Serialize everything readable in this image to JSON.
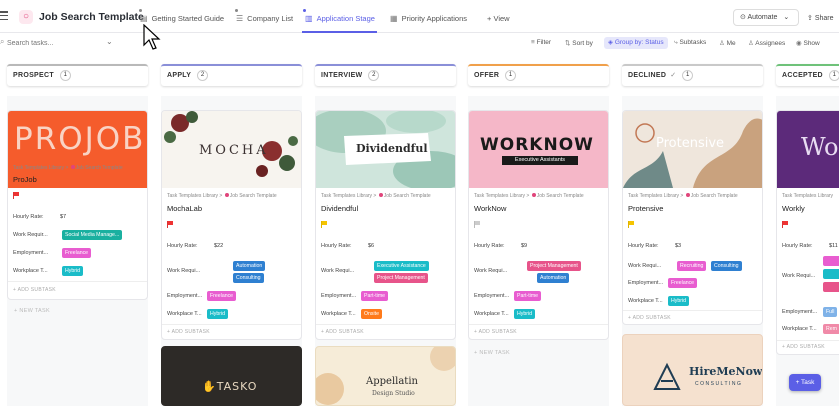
{
  "header": {
    "title": "Job Search Template",
    "tabs": [
      {
        "label": "Getting Started Guide"
      },
      {
        "label": "Company List"
      },
      {
        "label": "Application Stage"
      },
      {
        "label": "Priority Applications"
      }
    ],
    "add_view": "+ View",
    "automate": "Automate",
    "share": "Share"
  },
  "toolbar": {
    "search_placeholder": "Search tasks...",
    "filter": "Filter",
    "sort": "Sort by",
    "group": "Group by: Status",
    "subtasks": "Subtasks",
    "me": "Me",
    "assignees": "Assignees",
    "show": "Show"
  },
  "columns": [
    {
      "name": "PROSPECT",
      "count": "1",
      "color": "#b9b9b9"
    },
    {
      "name": "APPLY",
      "count": "2",
      "color": "#8a8fd8"
    },
    {
      "name": "INTERVIEW",
      "count": "2",
      "color": "#8a8fd8"
    },
    {
      "name": "OFFER",
      "count": "1",
      "color": "#f0a04b"
    },
    {
      "name": "DECLINED",
      "count": "1",
      "color": "#c9c9c9"
    },
    {
      "name": "ACCEPTED",
      "count": "1",
      "color": "#6fc27a"
    }
  ],
  "common": {
    "crumb_a": "Task Templates Library",
    "crumb_b": "Job Search Template",
    "hourly_rate": "Hourly Rate:",
    "work_req": "Work Requir...",
    "work_req_short": "Work Requi...",
    "employment": "Employment...",
    "workplace": "Workplace T...",
    "add_subtask": "+ ADD SUBTASK",
    "new_task": "+ NEW TASK"
  },
  "cards": {
    "projob": {
      "cover": "PROJOB",
      "name": "ProJob",
      "rate": "$7",
      "work": "Social Media Manage...",
      "employment": "Freelance",
      "workplace": "Hybrid"
    },
    "mochalab": {
      "cover": "MOCHA",
      "name": "MochaLab",
      "rate": "$22",
      "work1": "Automation",
      "work2": "Consulting",
      "employment": "Freelance",
      "workplace": "Hybrid"
    },
    "dividendful": {
      "cover": "Dividendful",
      "name": "Dividendful",
      "rate": "$6",
      "work1": "Executive Assistance",
      "work2": "Project Management",
      "employment": "Part-time",
      "workplace": "Onsite"
    },
    "worknow": {
      "cover": "WORKNOW",
      "cover_sub": "Executive Assistants",
      "name": "WorkNow",
      "rate": "$9",
      "work1": "Project Management",
      "work2": "Automation",
      "employment": "Part-time",
      "workplace": "Hybrid"
    },
    "protensive": {
      "cover": "Protensive",
      "name": "Protensive",
      "rate": "$3",
      "work1": "Recruiting",
      "work2": "Consulting",
      "employment": "Freelance",
      "workplace": "Hybrid"
    },
    "workly": {
      "cover": "Wo",
      "name": "Workly",
      "rate": "$11",
      "work1": "",
      "employment": "Full",
      "workplace": "Rem"
    },
    "tasko": {
      "cover": "TASKO"
    },
    "appellatin": {
      "cover": "Appellatin",
      "cover_sub": "Design Studio"
    },
    "hiremenow": {
      "cover": "HireMeNow",
      "cover_sub": "CONSULTING"
    }
  },
  "fab": {
    "label": "+ Task"
  },
  "colors": {
    "accent": "#5b5fe6",
    "tag_green": "#1ab0a0",
    "tag_pink": "#e85dd0",
    "tag_blue": "#2f80d1",
    "tag_teal": "#1abcc8",
    "tag_red": "#e7548a",
    "tag_orange": "#ff7a1a"
  }
}
